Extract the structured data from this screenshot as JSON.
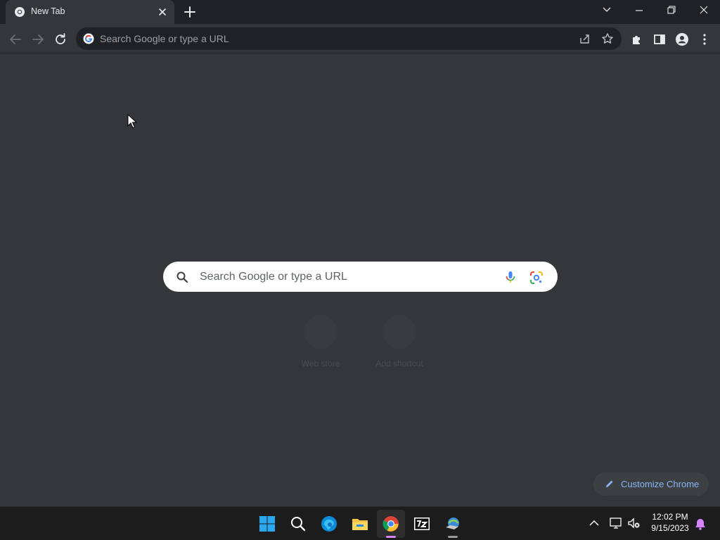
{
  "tab": {
    "title": "New Tab"
  },
  "omnibox": {
    "placeholder": "Search Google or type a URL"
  },
  "ntp": {
    "search_placeholder": "Search Google or type a URL",
    "shortcuts": [
      {
        "label": "Web store"
      },
      {
        "label": "Add shortcut"
      }
    ],
    "customize_label": "Customize Chrome"
  },
  "taskbar": {
    "apps": [
      {
        "name": "start-icon"
      },
      {
        "name": "search-icon"
      },
      {
        "name": "edge-icon"
      },
      {
        "name": "file-explorer-icon"
      },
      {
        "name": "chrome-icon",
        "active": true
      },
      {
        "name": "7zip-icon"
      },
      {
        "name": "internet-download-manager-icon"
      }
    ],
    "clock_time": "12:02 PM",
    "clock_date": "9/15/2023"
  },
  "colors": {
    "frame": "#202124",
    "toolbar": "#35363a",
    "accent": "#8ab4f8",
    "taskbar": "#1c1c1c"
  }
}
